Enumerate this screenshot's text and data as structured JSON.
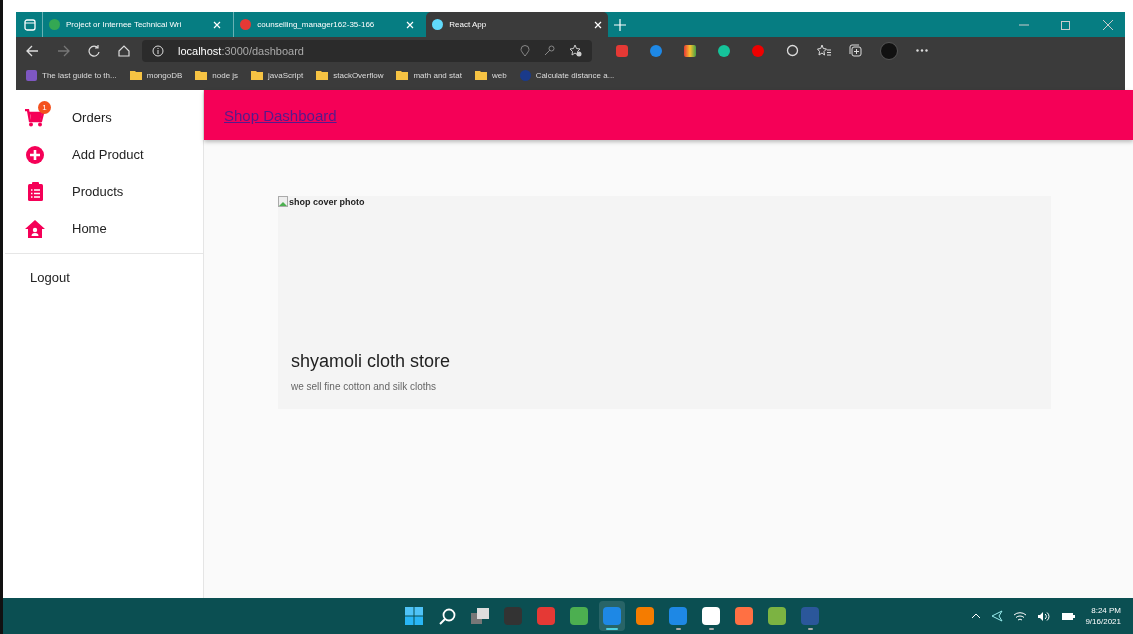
{
  "browser": {
    "tabs": [
      {
        "title": "Project or Internee Technical Wri",
        "kind": "drive",
        "selected": false
      },
      {
        "title": "counselling_manager162-35-166",
        "kind": "pdf",
        "selected": false
      },
      {
        "title": "React App",
        "kind": "react",
        "selected": true
      }
    ],
    "address": {
      "host": "localhost",
      "path": ":3000/dashboard"
    },
    "bookmarks": [
      {
        "label": "The last guide to th...",
        "kind": "rocket"
      },
      {
        "label": "mongoDB",
        "kind": "folder"
      },
      {
        "label": "node js",
        "kind": "folder"
      },
      {
        "label": "javaScript",
        "kind": "folder"
      },
      {
        "label": "stackOverflow",
        "kind": "folder"
      },
      {
        "label": "math and stat",
        "kind": "folder"
      },
      {
        "label": "web",
        "kind": "folder"
      },
      {
        "label": "Calculate distance a...",
        "kind": "site"
      }
    ]
  },
  "sidebar": {
    "items": [
      {
        "label": "Orders",
        "kind": "cart",
        "badge": "1"
      },
      {
        "label": "Add Product",
        "kind": "add"
      },
      {
        "label": "Products",
        "kind": "clipboard"
      },
      {
        "label": "Home",
        "kind": "home"
      }
    ],
    "footer_items": [
      {
        "label": "Logout"
      }
    ]
  },
  "app_bar": {
    "title": "Shop Dashboard"
  },
  "shop_card": {
    "cover_alt": "shop cover photo",
    "name": "shyamoli cloth store",
    "description": "we sell fine cotton and silk cloths"
  },
  "taskbar": {
    "apps": [
      {
        "kind": "start",
        "open": false,
        "selected": false
      },
      {
        "kind": "search",
        "open": false,
        "selected": false
      },
      {
        "kind": "taskview",
        "open": false,
        "selected": false
      },
      {
        "kind": "obs",
        "open": false,
        "selected": false
      },
      {
        "kind": "blocks",
        "open": false,
        "selected": false
      },
      {
        "kind": "chrome",
        "open": false,
        "selected": false
      },
      {
        "kind": "edge",
        "open": true,
        "selected": true
      },
      {
        "kind": "draw",
        "open": false,
        "selected": false
      },
      {
        "kind": "vscode",
        "open": true,
        "selected": false
      },
      {
        "kind": "mongo",
        "open": true,
        "selected": false
      },
      {
        "kind": "compass",
        "open": false,
        "selected": false
      },
      {
        "kind": "torrent",
        "open": false,
        "selected": false
      },
      {
        "kind": "word",
        "open": true,
        "selected": false
      }
    ],
    "time": "8:24 PM",
    "date": "9/16/2021"
  }
}
